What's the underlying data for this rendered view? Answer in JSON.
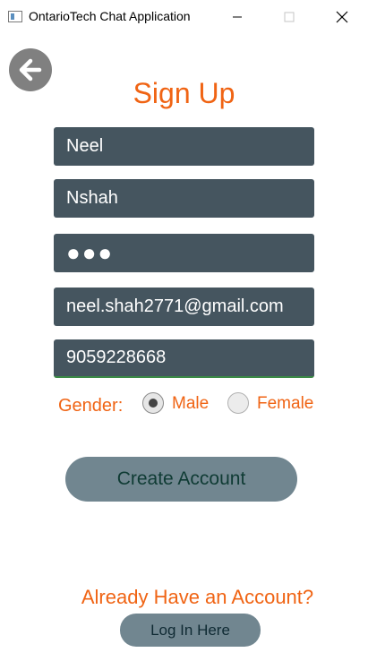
{
  "window": {
    "title": "OntarioTech Chat Application",
    "minimize_icon": "minimize-icon",
    "maximize_icon": "maximize-icon",
    "close_icon": "close-icon"
  },
  "back_icon": "arrow-left-icon",
  "page_title": "Sign Up",
  "form": {
    "first_name": "Neel",
    "username": "Nshah",
    "password": "●●●",
    "email": "neel.shah2771@gmail.com",
    "phone": "9059228668"
  },
  "gender": {
    "label": "Gender:",
    "options": [
      "Male",
      "Female"
    ],
    "selected": "Male"
  },
  "create_account_label": "Create Account",
  "already_have_account": "Already Have an Account?",
  "login_label": "Log In Here",
  "colors": {
    "accent": "#f06414",
    "field_bg": "#45555f",
    "button_bg": "#718690"
  }
}
